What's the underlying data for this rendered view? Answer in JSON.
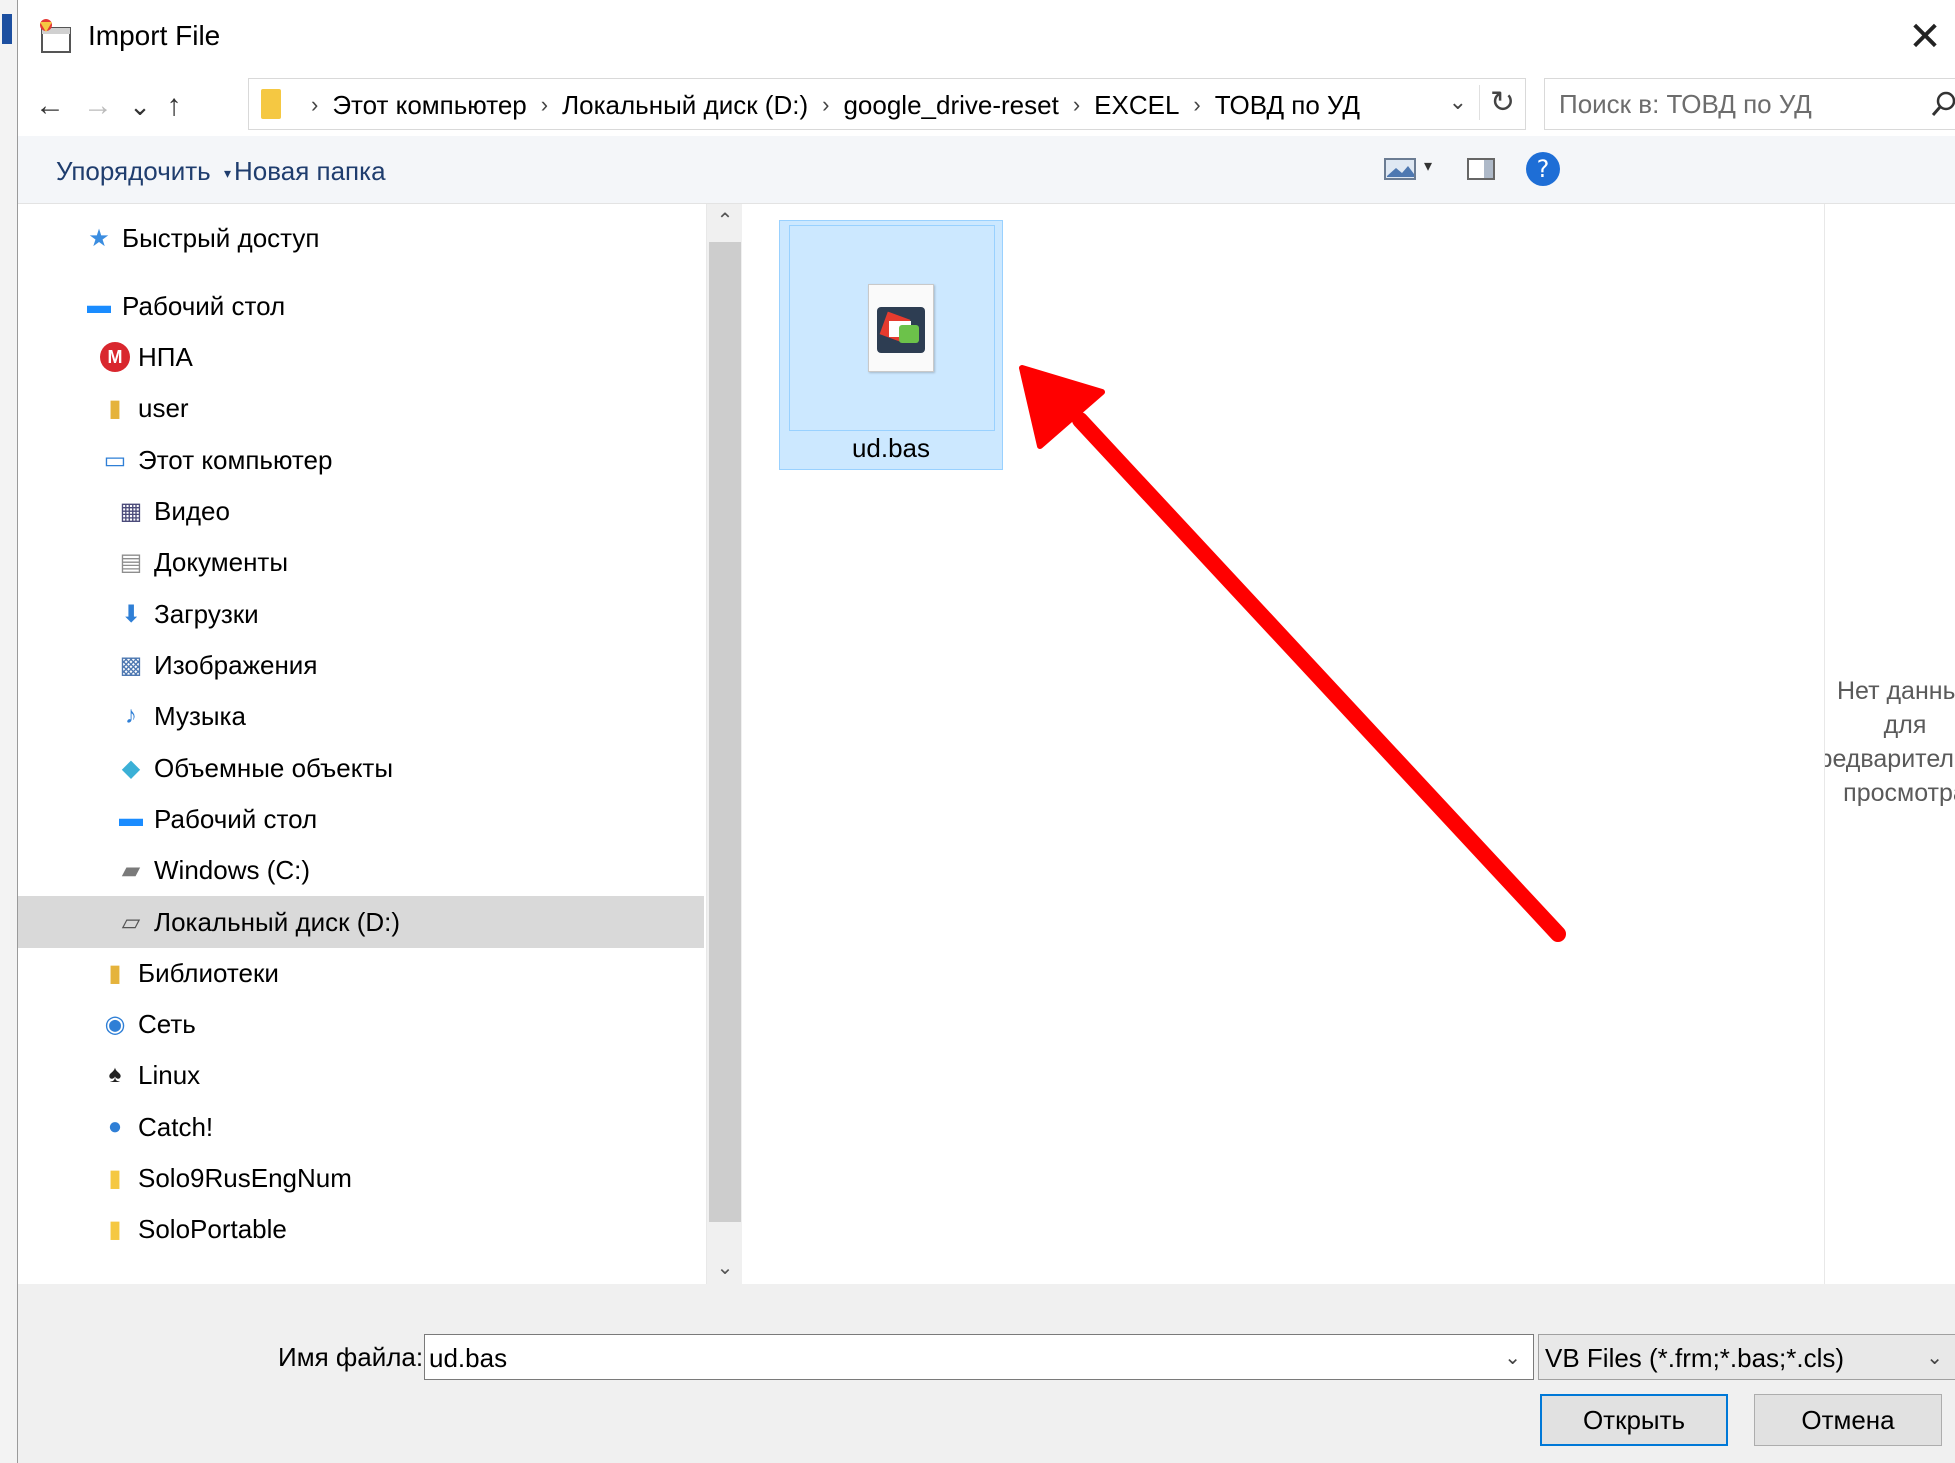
{
  "window": {
    "title": "Import File",
    "close_glyph": "✕"
  },
  "nav": {
    "back": "←",
    "forward": "→",
    "recent": "⌄",
    "up": "↑",
    "breadcrumbs": [
      "Этот компьютер",
      "Локальный диск (D:)",
      "google_drive-reset",
      "EXCEL",
      "ТОВД по УД"
    ],
    "separator": "›",
    "search_placeholder": "Поиск в: ТОВД по УД"
  },
  "toolbar": {
    "organize": "Упорядочить",
    "new_folder": "Новая папка"
  },
  "tree": {
    "items": [
      {
        "label": "Быстрый доступ",
        "icon": "star-icon"
      },
      {
        "label": "Рабочий стол",
        "icon": "desktop-icon"
      },
      {
        "label": "НПА",
        "icon": "mega-icon"
      },
      {
        "label": "user",
        "icon": "user-folder-icon"
      },
      {
        "label": "Этот компьютер",
        "icon": "computer-icon"
      },
      {
        "label": "Видео",
        "icon": "video-icon"
      },
      {
        "label": "Документы",
        "icon": "documents-icon"
      },
      {
        "label": "Загрузки",
        "icon": "downloads-icon"
      },
      {
        "label": "Изображения",
        "icon": "pictures-icon"
      },
      {
        "label": "Музыка",
        "icon": "music-icon"
      },
      {
        "label": "Объемные объекты",
        "icon": "3d-objects-icon"
      },
      {
        "label": "Рабочий стол",
        "icon": "desktop-icon"
      },
      {
        "label": "Windows (C:)",
        "icon": "drive-c-icon"
      },
      {
        "label": "Локальный диск (D:)",
        "icon": "drive-icon"
      },
      {
        "label": "Библиотеки",
        "icon": "libraries-icon"
      },
      {
        "label": "Сеть",
        "icon": "network-icon"
      },
      {
        "label": "Linux",
        "icon": "linux-icon"
      },
      {
        "label": "Catch!",
        "icon": "catch-icon"
      },
      {
        "label": "Solo9RusEngNum",
        "icon": "folder-icon"
      },
      {
        "label": "SoloPortable",
        "icon": "folder-icon"
      }
    ],
    "selected": "Локальный диск (D:)"
  },
  "files": [
    {
      "name": "ud.bas",
      "selected": true
    }
  ],
  "preview": {
    "lines": [
      "Нет данных",
      "для",
      "предварительного",
      "просмотра"
    ]
  },
  "bottom": {
    "filename_label": "Имя файла:",
    "filename_value": "ud.bas",
    "filter_value": "VB Files (*.frm;*.bas;*.cls)",
    "open_label": "Открыть",
    "cancel_label": "Отмена"
  },
  "colors": {
    "selection": "#cce8ff",
    "accent": "#0078d7",
    "annotation_arrow": "#ff0000"
  }
}
